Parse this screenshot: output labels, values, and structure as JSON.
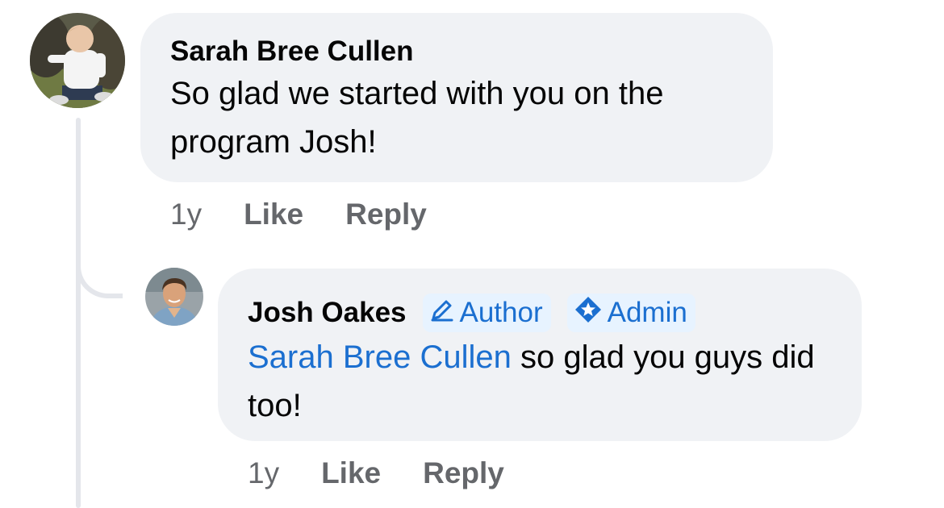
{
  "comments": [
    {
      "author": "Sarah Bree Cullen",
      "text": "So glad we started with you on the program Josh!",
      "time": "1y",
      "like_label": "Like",
      "reply_label": "Reply"
    },
    {
      "author": "Josh Oakes",
      "badges": {
        "author": "Author",
        "admin": "Admin"
      },
      "mention": "Sarah Bree Cullen",
      "text": " so glad you guys did too!",
      "time": "1y",
      "like_label": "Like",
      "reply_label": "Reply"
    }
  ],
  "colors": {
    "bubble": "#f0f2f5",
    "link_blue": "#1b6fd0",
    "meta_gray": "#65676b",
    "thread_line": "#e4e6eb"
  },
  "icons": {
    "author_badge": "pencil-icon",
    "admin_badge": "diamond-star-icon"
  }
}
